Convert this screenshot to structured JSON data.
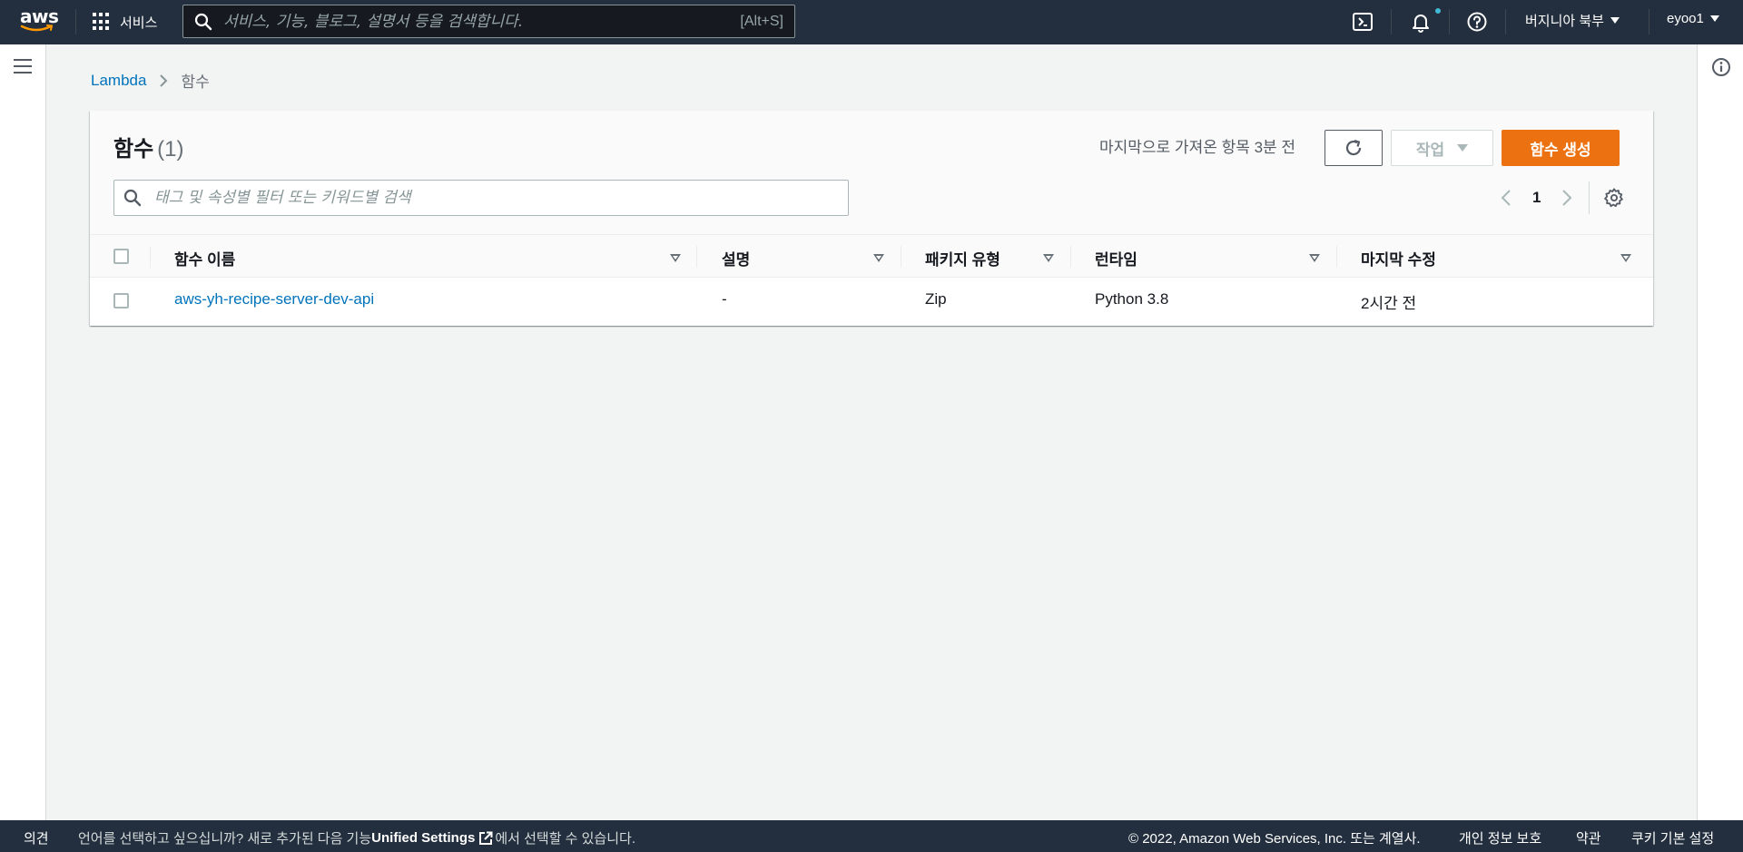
{
  "topnav": {
    "logo_text": "aws",
    "services_label": "서비스",
    "search_placeholder": "서비스, 기능, 블로그, 설명서 등을 검색합니다.",
    "search_shortcut": "[Alt+S]",
    "region_label": "버지니아 북부",
    "user_label": "eyoo1",
    "icons": [
      "cloudshell-icon",
      "bell-icon",
      "help-icon"
    ]
  },
  "breadcrumb": {
    "root": "Lambda",
    "current": "함수"
  },
  "panel": {
    "title": "함수",
    "count": "(1)",
    "last_fetched": "마지막으로 가져온 항목 3분 전",
    "actions_label": "작업",
    "create_label": "함수 생성",
    "filter_placeholder": "태그 및 속성별 필터 또는 키워드별 검색",
    "current_page": "1"
  },
  "table": {
    "columns": [
      "함수 이름",
      "설명",
      "패키지 유형",
      "런타임",
      "마지막 수정"
    ],
    "rows": [
      {
        "name": "aws-yh-recipe-server-dev-api",
        "description": "-",
        "package_type": "Zip",
        "runtime": "Python 3.8",
        "last_modified": "2시간 전"
      }
    ]
  },
  "footer": {
    "feedback": "의견",
    "lang_prefix": "언어를 선택하고 싶으십니까? 새로 추가된 다음 기능",
    "unified_settings": "Unified Settings",
    "lang_suffix": "에서 선택할 수 있습니다.",
    "copyright": "© 2022, Amazon Web Services, Inc. 또는 계열사.",
    "privacy": "개인 정보 보호",
    "terms": "약관",
    "cookie": "쿠키 기본 설정"
  },
  "colors": {
    "nav_bg": "#232f3e",
    "primary_button": "#ec7211",
    "link": "#0073bb",
    "notification_dot": "#44b9d6"
  }
}
